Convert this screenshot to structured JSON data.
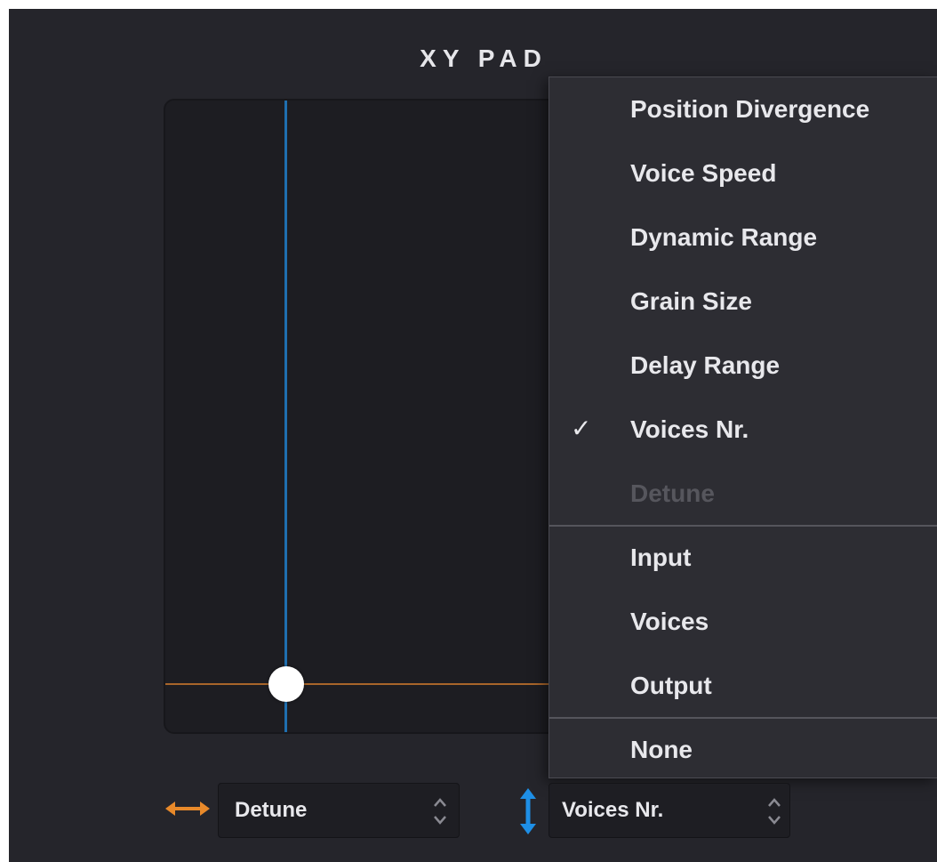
{
  "panel": {
    "title": "XY PAD"
  },
  "pad": {
    "x_position": 0.29,
    "y_position": 0.92,
    "colors": {
      "x_axis": "#a8652a",
      "y_axis": "#1f6fb0",
      "handle": "#ffffff"
    }
  },
  "dropdown_menu": {
    "items": [
      {
        "label": "Position Divergence",
        "checked": false,
        "disabled": false
      },
      {
        "label": "Voice Speed",
        "checked": false,
        "disabled": false
      },
      {
        "label": "Dynamic Range",
        "checked": false,
        "disabled": false
      },
      {
        "label": "Grain Size",
        "checked": false,
        "disabled": false
      },
      {
        "label": "Delay Range",
        "checked": false,
        "disabled": false
      },
      {
        "label": "Voices Nr.",
        "checked": true,
        "disabled": false
      },
      {
        "label": "Detune",
        "checked": false,
        "disabled": true
      },
      {
        "label": "Input",
        "checked": false,
        "disabled": false
      },
      {
        "label": "Voices",
        "checked": false,
        "disabled": false
      },
      {
        "label": "Output",
        "checked": false,
        "disabled": false
      },
      {
        "label": "None",
        "checked": false,
        "disabled": false
      }
    ],
    "check_glyph": "✓"
  },
  "controls": {
    "x_axis": {
      "icon": "horizontal-arrow-icon",
      "color": "#e8892a",
      "value": "Detune"
    },
    "y_axis": {
      "icon": "vertical-arrow-icon",
      "color": "#1e8fe6",
      "value": "Voices Nr."
    }
  }
}
